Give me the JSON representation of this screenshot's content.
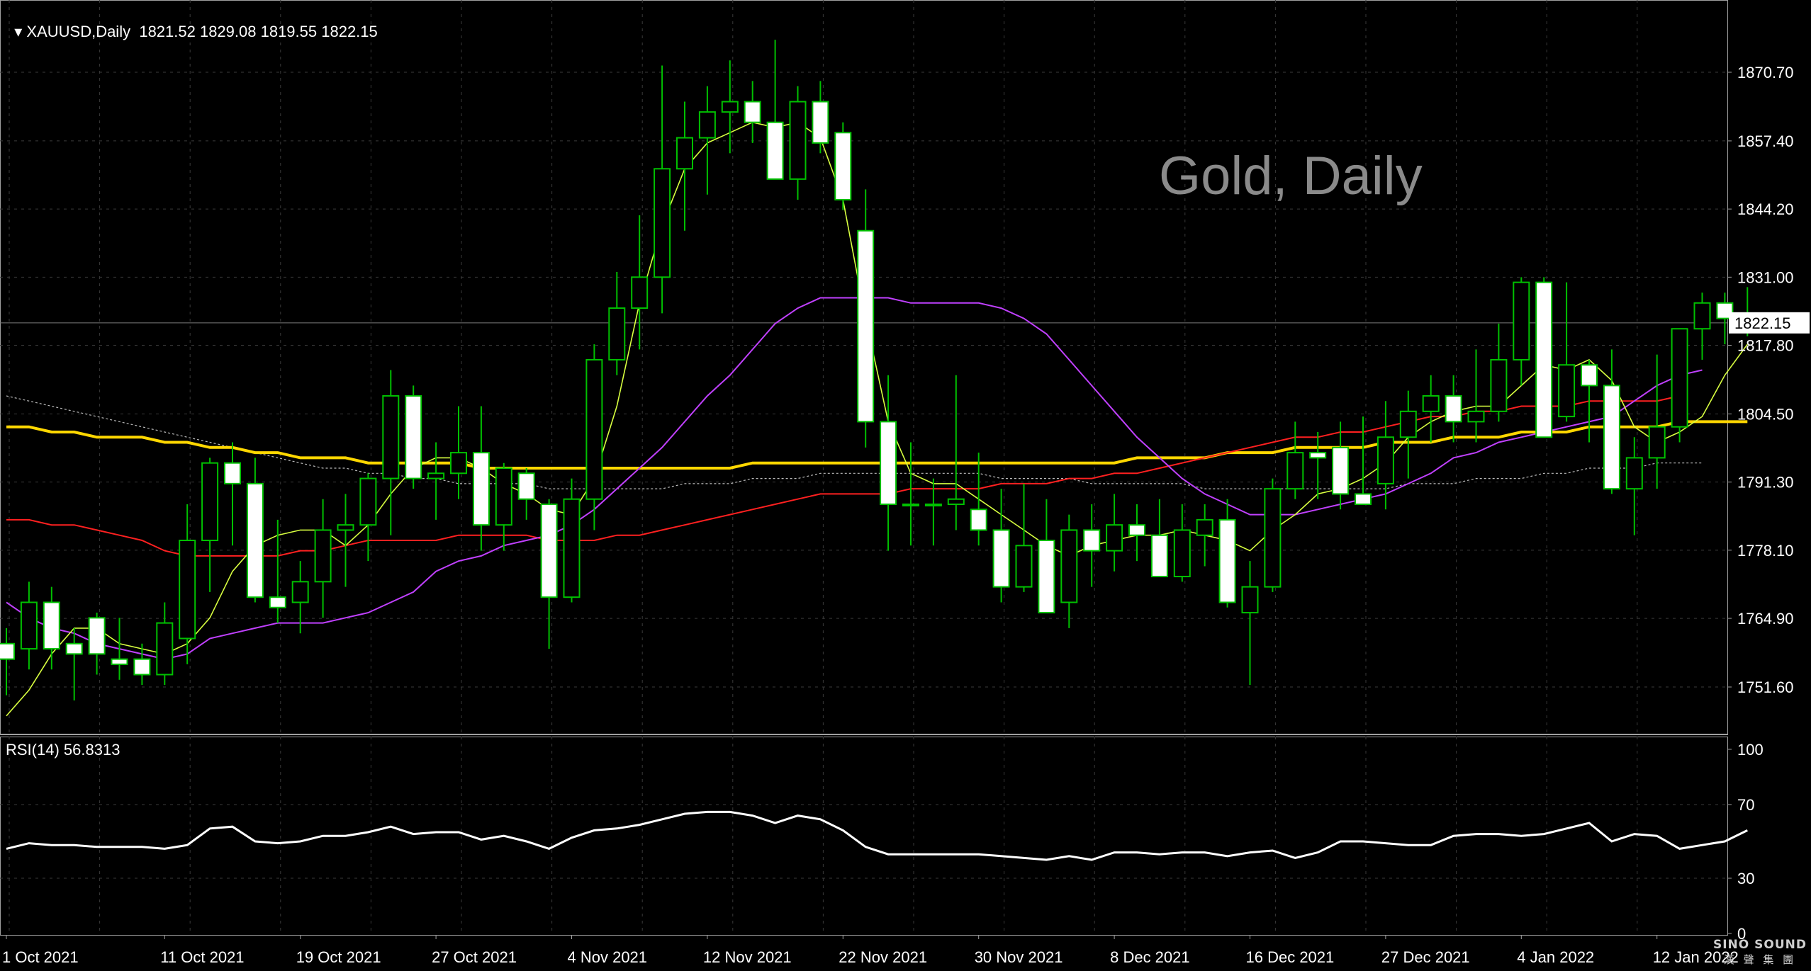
{
  "header": {
    "symbol_timeframe": "XAUUSD,Daily",
    "ohlc": "1821.52 1829.08 1819.55 1822.15"
  },
  "watermark": "Gold, Daily",
  "logo": {
    "line1": "SINO SOUND",
    "line2": "漢 聲 集 團"
  },
  "rsi": {
    "label": "RSI(14) 56.8313"
  },
  "colors": {
    "bull": "#00c000",
    "bear_body": "#ffffff",
    "ma_fast": "#d8ff40",
    "ma_mid": "#c040ff",
    "ma_slow": "#ff2020",
    "ma_long": "#ffd700",
    "ma_dotted": "#bbbbbb",
    "grid": "#3a3a3a",
    "rsi_line": "#ffffff"
  },
  "chart_data": {
    "type": "candlestick",
    "title": "XAUUSD,Daily",
    "y_ticks": [
      "1870.70",
      "1857.40",
      "1844.20",
      "1831.00",
      "1817.80",
      "1804.50",
      "1791.30",
      "1778.10",
      "1764.90",
      "1751.60"
    ],
    "ylim": [
      1745,
      1880
    ],
    "last_price": "1822.15",
    "x_tick_labels": [
      "1 Oct 2021",
      "11 Oct 2021",
      "19 Oct 2021",
      "27 Oct 2021",
      "4 Nov 2021",
      "12 Nov 2021",
      "22 Nov 2021",
      "30 Nov 2021",
      "8 Dec 2021",
      "16 Dec 2021",
      "27 Dec 2021",
      "4 Jan 2022",
      "12 Jan 2022"
    ],
    "x_tick_index": [
      0,
      7,
      13,
      19,
      25,
      31,
      37,
      43,
      49,
      55,
      61,
      67,
      73
    ],
    "candles": [
      {
        "o": 1760,
        "h": 1763,
        "l": 1750,
        "c": 1757
      },
      {
        "o": 1759,
        "h": 1772,
        "l": 1755,
        "c": 1768
      },
      {
        "o": 1768,
        "h": 1771,
        "l": 1755,
        "c": 1759
      },
      {
        "o": 1760,
        "h": 1763,
        "l": 1749,
        "c": 1758
      },
      {
        "o": 1765,
        "h": 1766,
        "l": 1754,
        "c": 1758
      },
      {
        "o": 1757,
        "h": 1765,
        "l": 1753,
        "c": 1756
      },
      {
        "o": 1757,
        "h": 1760,
        "l": 1752,
        "c": 1754
      },
      {
        "o": 1754,
        "h": 1768,
        "l": 1752,
        "c": 1764
      },
      {
        "o": 1761,
        "h": 1787,
        "l": 1756,
        "c": 1780
      },
      {
        "o": 1780,
        "h": 1796,
        "l": 1770,
        "c": 1795
      },
      {
        "o": 1795,
        "h": 1799,
        "l": 1779,
        "c": 1791
      },
      {
        "o": 1791,
        "h": 1796,
        "l": 1768,
        "c": 1769
      },
      {
        "o": 1769,
        "h": 1784,
        "l": 1764,
        "c": 1767
      },
      {
        "o": 1768,
        "h": 1776,
        "l": 1762,
        "c": 1772
      },
      {
        "o": 1772,
        "h": 1788,
        "l": 1765,
        "c": 1782
      },
      {
        "o": 1782,
        "h": 1789,
        "l": 1771,
        "c": 1783
      },
      {
        "o": 1783,
        "h": 1793,
        "l": 1776,
        "c": 1792
      },
      {
        "o": 1792,
        "h": 1813,
        "l": 1781,
        "c": 1808
      },
      {
        "o": 1808,
        "h": 1810,
        "l": 1790,
        "c": 1792
      },
      {
        "o": 1792,
        "h": 1799,
        "l": 1784,
        "c": 1793
      },
      {
        "o": 1793,
        "h": 1806,
        "l": 1788,
        "c": 1797
      },
      {
        "o": 1797,
        "h": 1806,
        "l": 1778,
        "c": 1783
      },
      {
        "o": 1783,
        "h": 1795,
        "l": 1778,
        "c": 1794
      },
      {
        "o": 1793,
        "h": 1794,
        "l": 1784,
        "c": 1788
      },
      {
        "o": 1787,
        "h": 1788,
        "l": 1759,
        "c": 1769
      },
      {
        "o": 1769,
        "h": 1792,
        "l": 1768,
        "c": 1788
      },
      {
        "o": 1788,
        "h": 1818,
        "l": 1782,
        "c": 1815
      },
      {
        "o": 1815,
        "h": 1832,
        "l": 1812,
        "c": 1825
      },
      {
        "o": 1825,
        "h": 1843,
        "l": 1817,
        "c": 1831
      },
      {
        "o": 1831,
        "h": 1872,
        "l": 1824,
        "c": 1852
      },
      {
        "o": 1852,
        "h": 1865,
        "l": 1840,
        "c": 1858
      },
      {
        "o": 1858,
        "h": 1868,
        "l": 1847,
        "c": 1863
      },
      {
        "o": 1863,
        "h": 1873,
        "l": 1855,
        "c": 1865
      },
      {
        "o": 1865,
        "h": 1869,
        "l": 1857,
        "c": 1861
      },
      {
        "o": 1861,
        "h": 1877,
        "l": 1850,
        "c": 1850
      },
      {
        "o": 1850,
        "h": 1868,
        "l": 1846,
        "c": 1865
      },
      {
        "o": 1865,
        "h": 1869,
        "l": 1855,
        "c": 1857
      },
      {
        "o": 1859,
        "h": 1861,
        "l": 1844,
        "c": 1846
      },
      {
        "o": 1840,
        "h": 1848,
        "l": 1798,
        "c": 1803
      },
      {
        "o": 1803,
        "h": 1812,
        "l": 1778,
        "c": 1787
      },
      {
        "o": 1787,
        "h": 1799,
        "l": 1779,
        "c": 1787
      },
      {
        "o": 1787,
        "h": 1792,
        "l": 1779,
        "c": 1787
      },
      {
        "o": 1787,
        "h": 1812,
        "l": 1782,
        "c": 1788
      },
      {
        "o": 1786,
        "h": 1797,
        "l": 1779,
        "c": 1782
      },
      {
        "o": 1782,
        "h": 1790,
        "l": 1768,
        "c": 1771
      },
      {
        "o": 1771,
        "h": 1791,
        "l": 1770,
        "c": 1779
      },
      {
        "o": 1780,
        "h": 1788,
        "l": 1766,
        "c": 1766
      },
      {
        "o": 1768,
        "h": 1785,
        "l": 1763,
        "c": 1782
      },
      {
        "o": 1782,
        "h": 1787,
        "l": 1771,
        "c": 1778
      },
      {
        "o": 1778,
        "h": 1789,
        "l": 1774,
        "c": 1783
      },
      {
        "o": 1783,
        "h": 1787,
        "l": 1776,
        "c": 1781
      },
      {
        "o": 1781,
        "h": 1788,
        "l": 1773,
        "c": 1773
      },
      {
        "o": 1773,
        "h": 1787,
        "l": 1772,
        "c": 1782
      },
      {
        "o": 1781,
        "h": 1787,
        "l": 1775,
        "c": 1784
      },
      {
        "o": 1784,
        "h": 1788,
        "l": 1767,
        "c": 1768
      },
      {
        "o": 1766,
        "h": 1776,
        "l": 1752,
        "c": 1771
      },
      {
        "o": 1771,
        "h": 1792,
        "l": 1770,
        "c": 1790
      },
      {
        "o": 1790,
        "h": 1803,
        "l": 1788,
        "c": 1797
      },
      {
        "o": 1797,
        "h": 1801,
        "l": 1788,
        "c": 1796
      },
      {
        "o": 1798,
        "h": 1803,
        "l": 1786,
        "c": 1789
      },
      {
        "o": 1789,
        "h": 1804,
        "l": 1787,
        "c": 1787
      },
      {
        "o": 1791,
        "h": 1807,
        "l": 1786,
        "c": 1800
      },
      {
        "o": 1800,
        "h": 1809,
        "l": 1792,
        "c": 1805
      },
      {
        "o": 1805,
        "h": 1812,
        "l": 1799,
        "c": 1808
      },
      {
        "o": 1808,
        "h": 1812,
        "l": 1799,
        "c": 1803
      },
      {
        "o": 1803,
        "h": 1817,
        "l": 1799,
        "c": 1805
      },
      {
        "o": 1805,
        "h": 1822,
        "l": 1803,
        "c": 1815
      },
      {
        "o": 1815,
        "h": 1831,
        "l": 1810,
        "c": 1830
      },
      {
        "o": 1830,
        "h": 1831,
        "l": 1800,
        "c": 1800
      },
      {
        "o": 1804,
        "h": 1830,
        "l": 1803,
        "c": 1814
      },
      {
        "o": 1814,
        "h": 1815,
        "l": 1799,
        "c": 1810
      },
      {
        "o": 1810,
        "h": 1817,
        "l": 1789,
        "c": 1790
      },
      {
        "o": 1790,
        "h": 1800,
        "l": 1781,
        "c": 1796
      },
      {
        "o": 1796,
        "h": 1816,
        "l": 1790,
        "c": 1802
      },
      {
        "o": 1802,
        "h": 1821,
        "l": 1799,
        "c": 1821
      },
      {
        "o": 1821,
        "h": 1828,
        "l": 1815,
        "c": 1826
      },
      {
        "o": 1826,
        "h": 1828,
        "l": 1818,
        "c": 1823
      },
      {
        "o": 1821.52,
        "h": 1829.08,
        "l": 1819.55,
        "c": 1822.15
      }
    ],
    "ma_fast_color": "#d8ff40",
    "ma_fast": [
      1746,
      1751,
      1758,
      1763,
      1763,
      1760,
      1759,
      1758,
      1760,
      1765,
      1774,
      1779,
      1781,
      1782,
      1782,
      1779,
      1783,
      1789,
      1794,
      1796,
      1796,
      1794,
      1791,
      1789,
      1786,
      1785,
      1792,
      1806,
      1826,
      1841,
      1852,
      1857,
      1859,
      1861,
      1860,
      1861,
      1858,
      1846,
      1823,
      1803,
      1793,
      1791,
      1791,
      1788,
      1785,
      1782,
      1779,
      1777,
      1779,
      1780,
      1781,
      1781,
      1782,
      1781,
      1780,
      1778,
      1782,
      1785,
      1789,
      1790,
      1792,
      1795,
      1800,
      1803,
      1805,
      1806,
      1806,
      1810,
      1814,
      1813,
      1815,
      1811,
      1802,
      1799,
      1801,
      1804,
      1812,
      1818
    ],
    "ma_mid_color": "#c040ff",
    "ma_mid": [
      1768,
      1765,
      1763,
      1762,
      1760,
      1759,
      1758,
      1757,
      1758,
      1761,
      1762,
      1763,
      1764,
      1764,
      1764,
      1765,
      1766,
      1768,
      1770,
      1774,
      1776,
      1777,
      1779,
      1780,
      1781,
      1783,
      1786,
      1790,
      1794,
      1798,
      1803,
      1808,
      1812,
      1817,
      1822,
      1825,
      1827,
      1827,
      1827,
      1827,
      1826,
      1826,
      1826,
      1826,
      1825,
      1823,
      1820,
      1815,
      1810,
      1805,
      1800,
      1796,
      1792,
      1789,
      1787,
      1785,
      1785,
      1785,
      1786,
      1787,
      1788,
      1789,
      1791,
      1793,
      1796,
      1797,
      1799,
      1800,
      1801,
      1802,
      1803,
      1804,
      1807,
      1810,
      1812,
      1813
    ],
    "ma_slow_color": "#ff2020",
    "ma_slow": [
      1784,
      1784,
      1783,
      1783,
      1782,
      1781,
      1780,
      1778,
      1777,
      1777,
      1777,
      1777,
      1777,
      1778,
      1778,
      1779,
      1780,
      1780,
      1780,
      1780,
      1781,
      1781,
      1781,
      1781,
      1780,
      1780,
      1780,
      1781,
      1781,
      1782,
      1783,
      1784,
      1785,
      1786,
      1787,
      1788,
      1789,
      1789,
      1789,
      1789,
      1790,
      1790,
      1790,
      1790,
      1791,
      1791,
      1791,
      1792,
      1792,
      1793,
      1793,
      1794,
      1795,
      1796,
      1797,
      1798,
      1799,
      1800,
      1800,
      1801,
      1801,
      1802,
      1803,
      1804,
      1804,
      1805,
      1805,
      1806,
      1806,
      1806,
      1807,
      1807,
      1807,
      1807,
      1808
    ],
    "ma_long_color": "#ffd700",
    "ma_long": [
      1802,
      1802,
      1801,
      1801,
      1800,
      1800,
      1800,
      1799,
      1799,
      1798,
      1798,
      1797,
      1797,
      1796,
      1796,
      1796,
      1795,
      1795,
      1795,
      1795,
      1795,
      1794,
      1794,
      1794,
      1794,
      1794,
      1794,
      1794,
      1794,
      1794,
      1794,
      1794,
      1794,
      1795,
      1795,
      1795,
      1795,
      1795,
      1795,
      1795,
      1795,
      1795,
      1795,
      1795,
      1795,
      1795,
      1795,
      1795,
      1795,
      1795,
      1796,
      1796,
      1796,
      1796,
      1797,
      1797,
      1797,
      1798,
      1798,
      1798,
      1798,
      1799,
      1799,
      1799,
      1800,
      1800,
      1800,
      1801,
      1801,
      1801,
      1802,
      1802,
      1802,
      1802,
      1803,
      1803,
      1803,
      1803
    ],
    "ma_dotted_color": "#bbbbbb",
    "ma_dotted": [
      1808,
      1807,
      1806,
      1805,
      1804,
      1803,
      1802,
      1801,
      1800,
      1799,
      1798,
      1797,
      1796,
      1795,
      1794,
      1794,
      1793,
      1793,
      1792,
      1792,
      1791,
      1791,
      1791,
      1791,
      1790,
      1790,
      1790,
      1790,
      1790,
      1790,
      1791,
      1791,
      1791,
      1792,
      1792,
      1792,
      1793,
      1793,
      1793,
      1793,
      1793,
      1793,
      1793,
      1793,
      1792,
      1792,
      1792,
      1792,
      1791,
      1791,
      1791,
      1791,
      1791,
      1790,
      1790,
      1790,
      1790,
      1790,
      1790,
      1790,
      1790,
      1790,
      1791,
      1791,
      1791,
      1792,
      1792,
      1792,
      1793,
      1793,
      1794,
      1794,
      1794,
      1795,
      1795,
      1795
    ],
    "rsi": {
      "title": "RSI(14) 56.8313",
      "y_ticks": [
        "100",
        "70",
        "30",
        "0"
      ],
      "ylim": [
        0,
        100
      ],
      "values": [
        46,
        49,
        48,
        48,
        47,
        47,
        47,
        46,
        48,
        57,
        58,
        50,
        49,
        50,
        53,
        53,
        55,
        58,
        54,
        55,
        55,
        51,
        53,
        50,
        46,
        52,
        56,
        57,
        59,
        62,
        65,
        66,
        66,
        64,
        60,
        64,
        62,
        56,
        47,
        43,
        43,
        43,
        43,
        43,
        42,
        41,
        40,
        42,
        40,
        44,
        44,
        43,
        44,
        44,
        42,
        44,
        45,
        41,
        44,
        50,
        50,
        49,
        48,
        48,
        53,
        54,
        54,
        53,
        54,
        57,
        60,
        50,
        54,
        53,
        46,
        48,
        50,
        56,
        57,
        56,
        56
      ]
    }
  }
}
